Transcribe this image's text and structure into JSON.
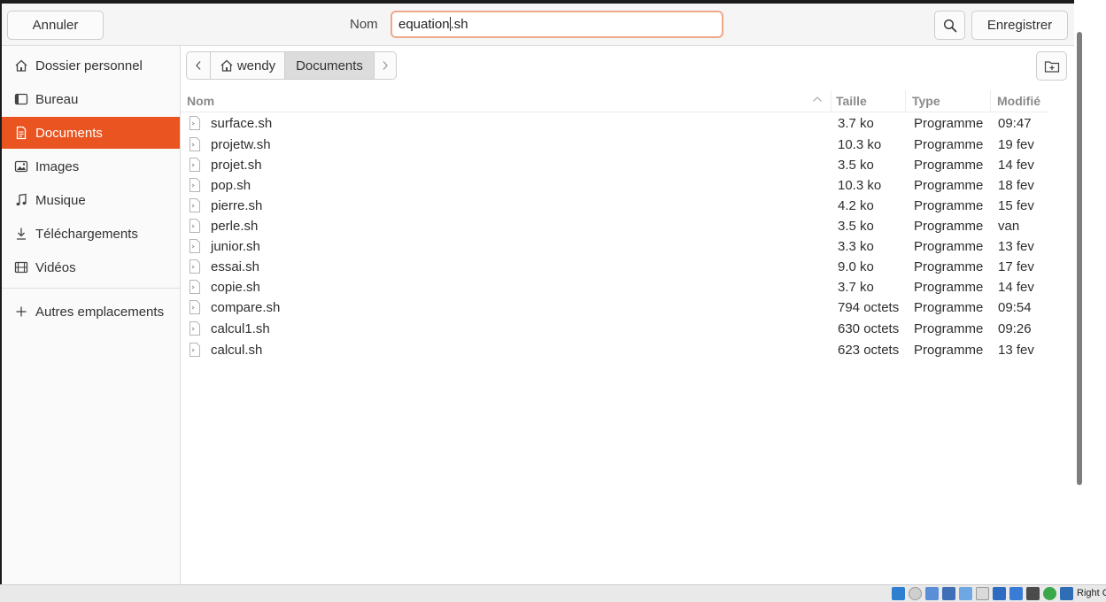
{
  "header": {
    "cancel_label": "Annuler",
    "name_label": "Nom",
    "filename_before_cursor": "equation",
    "filename_after_cursor": ".sh",
    "save_label": "Enregistrer"
  },
  "sidebar": {
    "items": [
      {
        "label": "Dossier personnel",
        "icon": "home-icon"
      },
      {
        "label": "Bureau",
        "icon": "desktop-icon"
      },
      {
        "label": "Documents",
        "icon": "document-icon",
        "active": true
      },
      {
        "label": "Images",
        "icon": "image-icon"
      },
      {
        "label": "Musique",
        "icon": "music-icon"
      },
      {
        "label": "Téléchargements",
        "icon": "download-icon"
      },
      {
        "label": "Vidéos",
        "icon": "video-icon"
      }
    ],
    "other_locations_label": "Autres emplacements"
  },
  "pathbar": {
    "home_label": "wendy",
    "current_label": "Documents"
  },
  "columns": {
    "name": "Nom",
    "size": "Taille",
    "type": "Type",
    "modified": "Modifié"
  },
  "files": [
    {
      "name": "surface.sh",
      "size": "3.7 ko",
      "type": "Programme",
      "modified": "09:47"
    },
    {
      "name": "projetw.sh",
      "size": "10.3 ko",
      "type": "Programme",
      "modified": "19 fev"
    },
    {
      "name": "projet.sh",
      "size": "3.5 ko",
      "type": "Programme",
      "modified": "14 fev"
    },
    {
      "name": "pop.sh",
      "size": "10.3 ko",
      "type": "Programme",
      "modified": "18 fev"
    },
    {
      "name": "pierre.sh",
      "size": "4.2 ko",
      "type": "Programme",
      "modified": "15 fev"
    },
    {
      "name": "perle.sh",
      "size": "3.5 ko",
      "type": "Programme",
      "modified": "van"
    },
    {
      "name": "junior.sh",
      "size": "3.3 ko",
      "type": "Programme",
      "modified": "13 fev"
    },
    {
      "name": "essai.sh",
      "size": "9.0 ko",
      "type": "Programme",
      "modified": "17 fev"
    },
    {
      "name": "copie.sh",
      "size": "3.7 ko",
      "type": "Programme",
      "modified": "14 fev"
    },
    {
      "name": "compare.sh",
      "size": "794 octets",
      "type": "Programme",
      "modified": "09:54"
    },
    {
      "name": "calcul1.sh",
      "size": "630 octets",
      "type": "Programme",
      "modified": "09:26"
    },
    {
      "name": "calcul.sh",
      "size": "623 octets",
      "type": "Programme",
      "modified": "13 fev"
    }
  ],
  "statusbar": {
    "host_key_text": "Right C"
  },
  "colors": {
    "accent": "#e95420",
    "input_border": "#f0a889"
  }
}
